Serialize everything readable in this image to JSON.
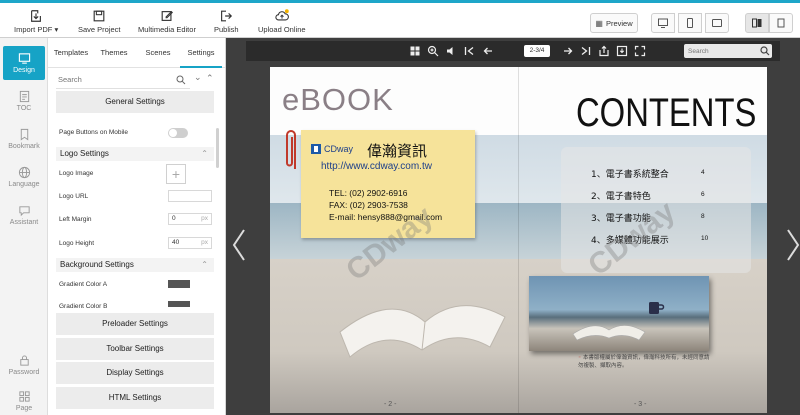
{
  "toolbar": {
    "import_pdf": "Import PDF",
    "save_project": "Save Project",
    "multimedia_editor": "Multimedia Editor",
    "publish": "Publish",
    "upload_online": "Upload Online",
    "preview": "Preview"
  },
  "rail": {
    "design": "Design",
    "toc": "TOC",
    "bookmark": "Bookmark",
    "language": "Language",
    "assistant": "Assistant",
    "password": "Password",
    "page": "Page"
  },
  "panel": {
    "tabs": [
      "Templates",
      "Themes",
      "Scenes",
      "Settings"
    ],
    "search_placeholder": "Search",
    "general_settings": "General Settings",
    "page_buttons_on_mobile": "Page Buttons on Mobile",
    "logo_settings": "Logo Settings",
    "logo_image": "Logo Image",
    "logo_url": "Logo URL",
    "left_margin": "Left Margin",
    "left_margin_value": "0",
    "logo_height": "Logo Height",
    "logo_height_value": "40",
    "unit_px": "px",
    "background_settings": "Background Settings",
    "gradient_color_a": "Gradient Color A",
    "gradient_color_b": "Gradient Color B",
    "preloader_settings": "Preloader Settings",
    "toolbar_settings": "Toolbar Settings",
    "display_settings": "Display Settings",
    "html_settings": "HTML Settings"
  },
  "viewer": {
    "page_indicator": "2-3/4",
    "search_placeholder": "Search"
  },
  "book": {
    "ebook_title": "eBOOK",
    "contents_title": "CONTENTS",
    "card": {
      "brand": "CDway",
      "company": "偉瀚資訊",
      "url": "http://www.cdway.com.tw",
      "tel": "TEL: (02) 2902-6916",
      "fax": "FAX: (02) 2903-7538",
      "email": "E-mail: hensy888@gmail.com"
    },
    "toc": [
      {
        "label": "1、電子書系統整合",
        "page": "4"
      },
      {
        "label": "2、電子書特色",
        "page": "6"
      },
      {
        "label": "3、電子書功能",
        "page": "8"
      },
      {
        "label": "4、多媒體功能展示",
        "page": "10"
      }
    ],
    "watermark": "CDway",
    "note": "本書版權屬於偉瀚資訊，偉瀚科技所有，未經同意請勿複製、擷取內容。",
    "page_left": "- 2 -",
    "page_right": "- 3 -"
  },
  "colors": {
    "accent": "#16a3c6",
    "card": "#f6e39a"
  }
}
